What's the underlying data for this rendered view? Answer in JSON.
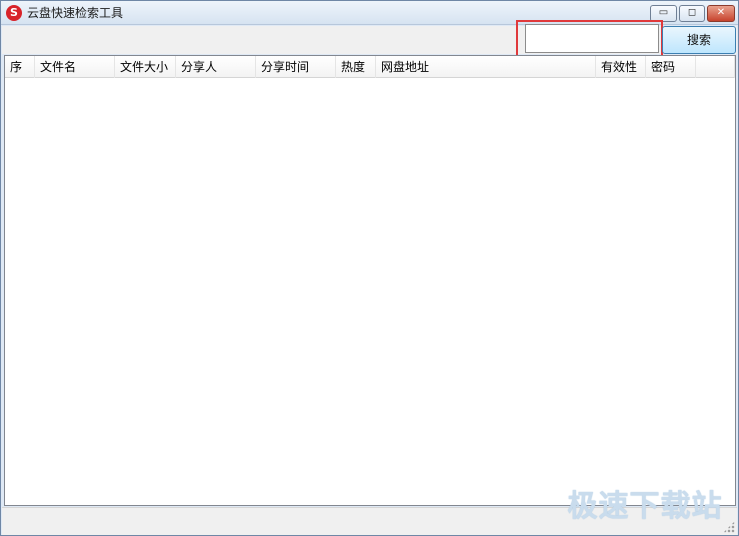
{
  "window": {
    "app_icon_glyph": "S",
    "title": "云盘快速检索工具",
    "controls": {
      "minimize": "▭",
      "maximize": "◻",
      "close": "✕"
    }
  },
  "search": {
    "value": "",
    "placeholder": "",
    "button_label": "搜索"
  },
  "table": {
    "columns": [
      {
        "key": "index",
        "label": "序"
      },
      {
        "key": "filename",
        "label": "文件名"
      },
      {
        "key": "filesize",
        "label": "文件大小"
      },
      {
        "key": "sharer",
        "label": "分享人"
      },
      {
        "key": "share_time",
        "label": "分享时间"
      },
      {
        "key": "popularity",
        "label": "热度"
      },
      {
        "key": "url",
        "label": "网盘地址"
      },
      {
        "key": "validity",
        "label": "有效性"
      },
      {
        "key": "password",
        "label": "密码"
      },
      {
        "key": "extra",
        "label": ""
      }
    ],
    "rows": []
  },
  "watermark": "极速下载站",
  "colors": {
    "highlight_border": "#e0393b",
    "app_icon": "#d8232a",
    "button_border": "#3c7fb1"
  }
}
